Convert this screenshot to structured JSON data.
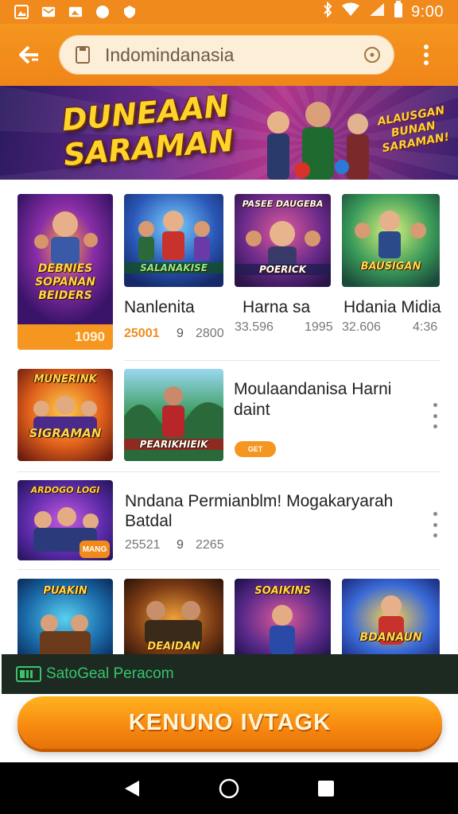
{
  "status_bar": {
    "time": "9:00",
    "icons": [
      "gallery-icon",
      "mail-icon",
      "photo-icon",
      "circle-icon",
      "shield-icon",
      "bluetooth-icon",
      "wifi-icon",
      "signal-icon",
      "battery-icon"
    ]
  },
  "app_bar": {
    "url": "Indomindanasia",
    "back_icon": "back-arrow-icon",
    "menu_icon": "more-vert-icon"
  },
  "banner": {
    "title": "DUNEAAN SARAMAN",
    "subtitle": "ALAUSGAN BUNAN SARAMAN!"
  },
  "featured": {
    "tile_label": "DEBNIES SOPANAN BEIDERS",
    "price": "1090",
    "items": [
      {
        "tile_label": "SALANAKISE",
        "title": "Nanlenita",
        "stat_a": "25001",
        "stat_b": "9",
        "stat_c": "2800"
      },
      {
        "tile_label": "POERICK",
        "tile_top": "PASEE DAUGEBA",
        "title": "Harna sa",
        "stat_a": "33.596",
        "stat_b": "1995"
      },
      {
        "tile_label": "BAUSIGAN",
        "title": "Hdania Midia",
        "stat_a": "32.606",
        "stat_b": "4:36"
      }
    ]
  },
  "list_items": [
    {
      "tile_label": "SIGRAMAN",
      "tile_top": "MUNERINK",
      "second_tile_label": "PEARIKHIEIK",
      "title_line1": "Moulaandanisa Harni",
      "title_line2": "daint",
      "badge": "GET"
    },
    {
      "tile_label": "ARDOGO LOGI",
      "badge": "MANG",
      "title_line1": "Nndana Permianblm! Mogakaryarah",
      "title_line2": "Batdal",
      "stat_a": "25521",
      "stat_b": "9",
      "stat_c": "2265"
    }
  ],
  "bottom_row": [
    {
      "tile_label": "PUAKIN"
    },
    {
      "tile_label": "DEAIDAN"
    },
    {
      "tile_label": "SOAIKINS"
    },
    {
      "tile_label": "BDANAUN"
    }
  ],
  "promo": {
    "text": "SatoGeal Peracom"
  },
  "cta": {
    "label": "KENUNO IVTAGK"
  },
  "colors": {
    "accent": "#f08a1c",
    "cta": "#f7880f",
    "promo_bg": "#1c2a22",
    "promo_text": "#38c46a"
  }
}
